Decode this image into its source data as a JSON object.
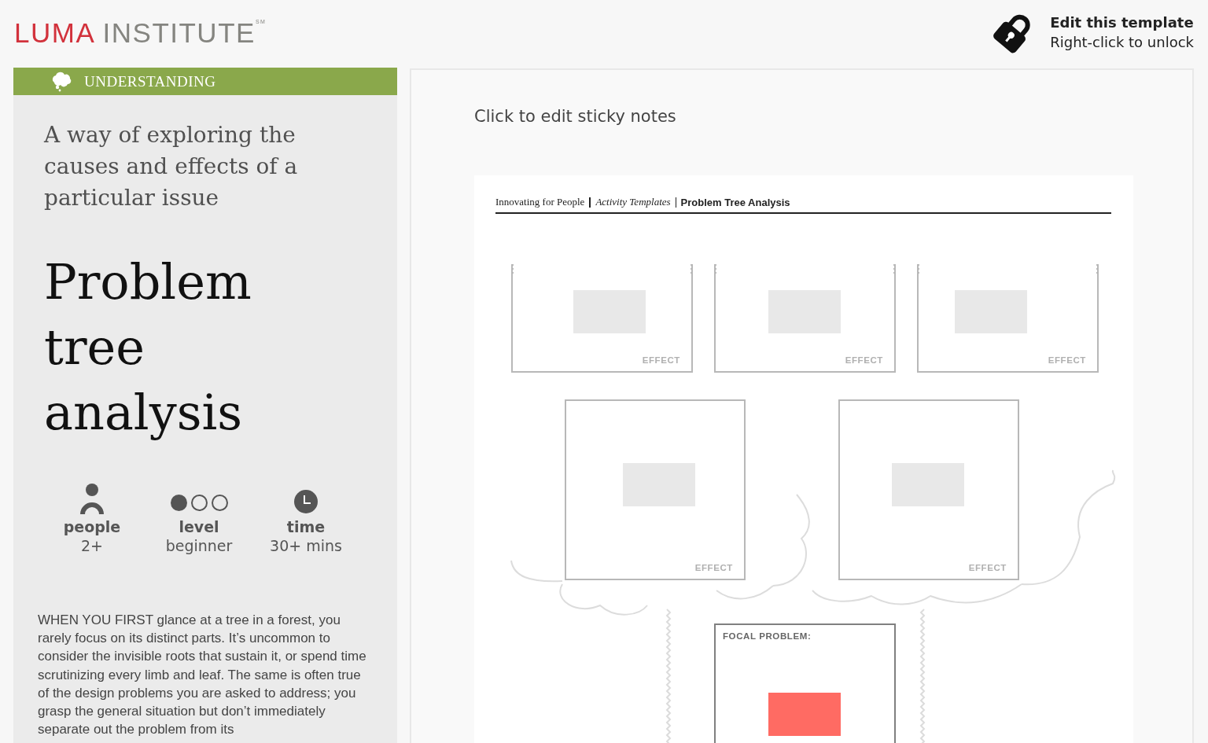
{
  "logo": {
    "brand": "LUMA",
    "rest": "INSTITUTE",
    "mark": "SM"
  },
  "unlock": {
    "title": "Edit this template",
    "hint": "Right-click to unlock"
  },
  "category": {
    "label": "UNDERSTANDING"
  },
  "tagline": "A way of exploring the causes and effects of a particular issue",
  "method_title": "Problem tree analysis",
  "stats": [
    {
      "kind": "people",
      "label": "people",
      "value": "2+"
    },
    {
      "kind": "level",
      "label": "level",
      "value": "beginner",
      "stars": 1
    },
    {
      "kind": "time",
      "label": "time",
      "value": "30+ mins"
    }
  ],
  "description": "WHEN YOU FIRST glance at a tree in a forest, you rarely focus on its distinct parts. It’s uncommon to consider the invisible roots that sustain it, or spend time scrutinizing every limb and leaf. The same is often true of the design problems you are asked to address; you grasp the general situation but don’t immediately separate out the problem from its",
  "canvas": {
    "instruction": "Click to edit sticky notes",
    "template": {
      "breadcrumb": [
        {
          "kind": "plain",
          "text": "Innovating for People"
        },
        {
          "kind": "italic",
          "text": "Activity Templates"
        },
        {
          "kind": "bold",
          "text": "Problem Tree Analysis"
        }
      ],
      "boxes": [
        {
          "kind": "open",
          "label": "EFFECT",
          "note": {
            "color": "#e8e8e8"
          }
        },
        {
          "kind": "open",
          "label": "EFFECT",
          "note": {
            "color": "#e8e8e8"
          }
        },
        {
          "kind": "open",
          "label": "EFFECT",
          "note": {
            "color": "#e8e8e8"
          }
        },
        {
          "kind": "square",
          "label": "EFFECT",
          "note": {
            "color": "#e8e8e8"
          }
        },
        {
          "kind": "square",
          "label": "EFFECT",
          "note": {
            "color": "#e8e8e8"
          }
        },
        {
          "kind": "focal",
          "label": "FOCAL PROBLEM:",
          "note": {
            "color": "#ff6b63"
          }
        }
      ]
    }
  }
}
